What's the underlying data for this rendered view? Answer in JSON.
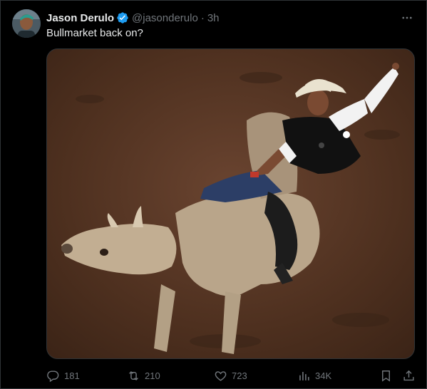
{
  "tweet": {
    "author_name": "Jason Derulo",
    "handle": "@jasonderulo",
    "separator": "·",
    "time": "3h",
    "text": "Bullmarket back on?",
    "verified_icon": "verified-badge-icon",
    "more_icon": "more-options-icon"
  },
  "media": {
    "description_icon": "photo-bull-rider"
  },
  "actions": {
    "replies": "181",
    "reposts": "210",
    "likes": "723",
    "views": "34K"
  },
  "colors": {
    "background": "#000000",
    "text_primary": "#e7e9ea",
    "text_secondary": "#71767b",
    "verified": "#1d9bf0",
    "border": "#2f3336"
  }
}
